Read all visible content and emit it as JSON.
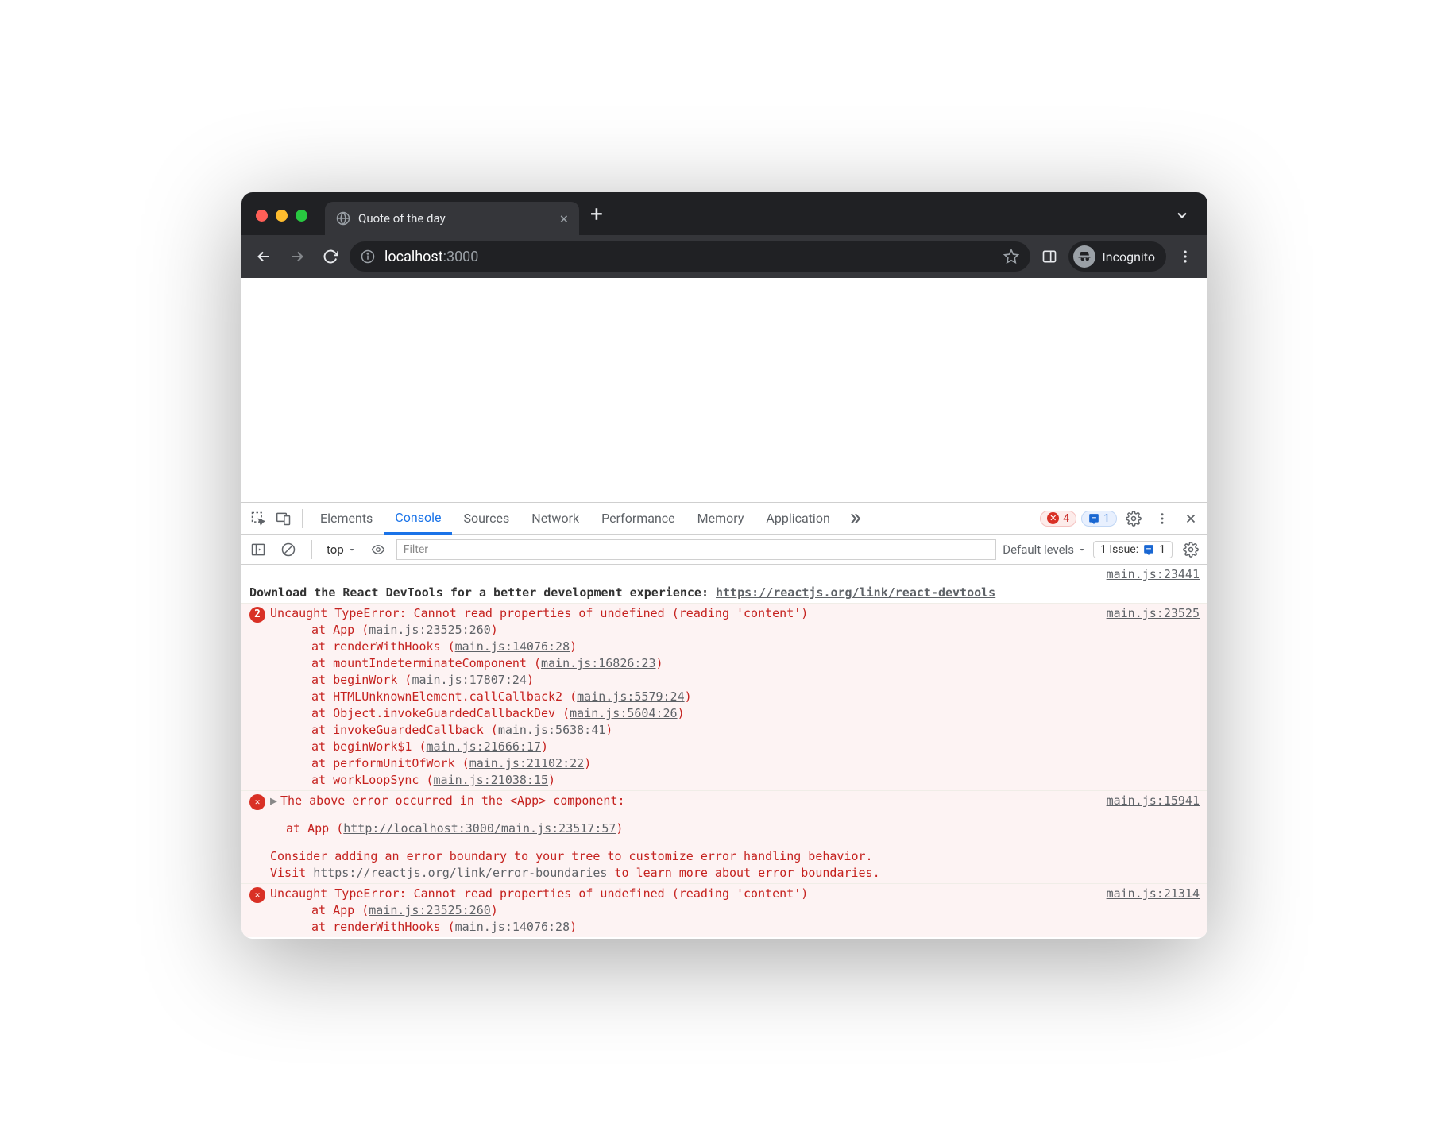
{
  "browser": {
    "tab_title": "Quote of the day",
    "address_host": "localhost",
    "address_port": ":3000",
    "incognito_label": "Incognito"
  },
  "devtools": {
    "tabs": [
      "Elements",
      "Console",
      "Sources",
      "Network",
      "Performance",
      "Memory",
      "Application"
    ],
    "active_tab": "Console",
    "error_count": "4",
    "info_count": "1",
    "context": "top",
    "filter_placeholder": "Filter",
    "levels_label": "Default levels",
    "issues_label": "1 Issue:",
    "issues_count": "1"
  },
  "console": {
    "row0_src": "main.js:23441",
    "row0_text": "Download the React DevTools for a better development experience: ",
    "row0_link": "https://reactjs.org/link/react-devtools",
    "err1": {
      "badge": "2",
      "src": "main.js:23525",
      "title": "Uncaught TypeError: Cannot read properties of undefined (reading 'content')",
      "stack": [
        {
          "pre": "at App (",
          "lnk": "main.js:23525:260",
          "post": ")"
        },
        {
          "pre": "at renderWithHooks (",
          "lnk": "main.js:14076:28",
          "post": ")"
        },
        {
          "pre": "at mountIndeterminateComponent (",
          "lnk": "main.js:16826:23",
          "post": ")"
        },
        {
          "pre": "at beginWork (",
          "lnk": "main.js:17807:24",
          "post": ")"
        },
        {
          "pre": "at HTMLUnknownElement.callCallback2 (",
          "lnk": "main.js:5579:24",
          "post": ")"
        },
        {
          "pre": "at Object.invokeGuardedCallbackDev (",
          "lnk": "main.js:5604:26",
          "post": ")"
        },
        {
          "pre": "at invokeGuardedCallback (",
          "lnk": "main.js:5638:41",
          "post": ")"
        },
        {
          "pre": "at beginWork$1 (",
          "lnk": "main.js:21666:17",
          "post": ")"
        },
        {
          "pre": "at performUnitOfWork (",
          "lnk": "main.js:21102:22",
          "post": ")"
        },
        {
          "pre": "at workLoopSync (",
          "lnk": "main.js:21038:15",
          "post": ")"
        }
      ]
    },
    "err2": {
      "src": "main.js:15941",
      "line1": "The above error occurred in the <App> component:",
      "line2_pre": "    at App (",
      "line2_lnk": "http://localhost:3000/main.js:23517:57",
      "line2_post": ")",
      "line3": "Consider adding an error boundary to your tree to customize error handling behavior.",
      "line4_pre": "Visit ",
      "line4_lnk": "https://reactjs.org/link/error-boundaries",
      "line4_post": " to learn more about error boundaries."
    },
    "err3": {
      "src": "main.js:21314",
      "title": "Uncaught TypeError: Cannot read properties of undefined (reading 'content')",
      "stack": [
        {
          "pre": "at App (",
          "lnk": "main.js:23525:260",
          "post": ")"
        },
        {
          "pre": "at renderWithHooks (",
          "lnk": "main.js:14076:28",
          "post": ")"
        }
      ]
    }
  }
}
